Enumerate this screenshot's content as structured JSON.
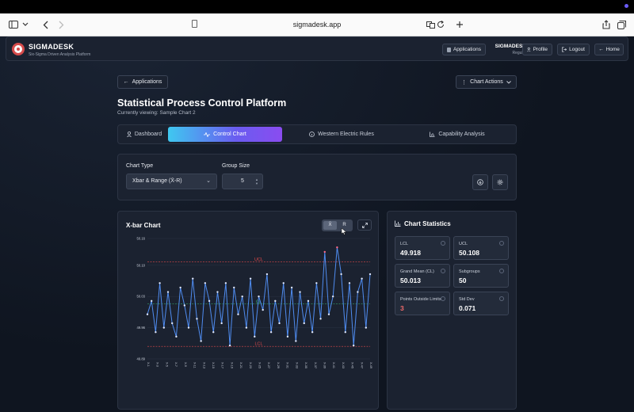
{
  "browser": {
    "url": "sigmadesk.app",
    "icons": [
      "sidebar-icon",
      "chevron-down-icon",
      "back-icon",
      "forward-icon",
      "reader-icon",
      "translate-icon",
      "reload-icon",
      "new-tab-icon",
      "share-icon",
      "tabs-icon"
    ]
  },
  "header": {
    "brand": "SIGMADESK",
    "tagline": "Six-Sigma Driven Analysis Platform",
    "applications_label": "Applications",
    "user_name": "SIGMADESK",
    "user_role": "Regular",
    "profile_label": "Profile",
    "logout_label": "Logout",
    "home_label": "Home"
  },
  "page": {
    "back_label": "Applications",
    "actions_label": "Chart Actions",
    "title": "Statistical Process Control Platform",
    "subtitle": "Currently viewing: Sample Chart 2"
  },
  "tabs": [
    {
      "label": "Dashboard",
      "icon": "user-icon",
      "active": false
    },
    {
      "label": "Control Chart",
      "icon": "activity-icon",
      "active": true
    },
    {
      "label": "Western Electric Rules",
      "icon": "info-icon",
      "active": false
    },
    {
      "label": "Capability Analysis",
      "icon": "bar-chart-icon",
      "active": false
    }
  ],
  "controls": {
    "chart_type_label": "Chart Type",
    "chart_type_value": "Xbar & Range (X̄-R)",
    "group_size_label": "Group Size",
    "group_size_value": "5"
  },
  "chart": {
    "title": "X-bar Chart",
    "toggle_xbar": "X̄",
    "toggle_r": "R"
  },
  "chart_data": {
    "type": "line",
    "title": "X-bar Chart",
    "ylim": [
      49.89,
      50.16
    ],
    "yticks": [
      "50.16",
      "50.10",
      "50.03",
      "49.96",
      "49.89"
    ],
    "xticks": [
      "X-1",
      "X-3",
      "X-5",
      "X-7",
      "X-9",
      "X-11",
      "X-13",
      "X-15",
      "X-17",
      "X-19",
      "X-21",
      "X-23",
      "X-25",
      "X-27",
      "X-29",
      "X-31",
      "X-33",
      "X-35",
      "X-37",
      "X-39",
      "X-41",
      "X-43",
      "X-45",
      "X-47",
      "X-49"
    ],
    "limits": {
      "UCL": 50.108,
      "CL": 50.013,
      "LCL": 49.918
    },
    "limit_labels": {
      "UCL": "UCL",
      "CL": "CL",
      "LCL": "LCL"
    },
    "colors": {
      "series": "#4f8cf0",
      "limit": "#e04a4a",
      "center": "#34c07a",
      "out_of_control": "#ff6a8a"
    },
    "values": [
      49.99,
      50.02,
      49.95,
      50.06,
      49.96,
      50.04,
      49.97,
      49.94,
      50.05,
      50.01,
      49.96,
      50.07,
      49.98,
      49.93,
      50.06,
      50.02,
      49.95,
      50.04,
      49.97,
      50.06,
      49.92,
      50.05,
      49.99,
      50.03,
      49.96,
      50.07,
      49.94,
      50.03,
      50.0,
      50.08,
      49.95,
      50.02,
      49.97,
      50.06,
      49.94,
      50.05,
      49.93,
      50.04,
      49.97,
      50.02,
      49.95,
      50.06,
      49.98,
      50.13,
      49.99,
      50.03,
      50.14,
      50.08,
      49.95,
      50.06,
      49.92,
      50.04,
      50.07,
      49.96,
      50.08
    ]
  },
  "stats": {
    "title": "Chart Statistics",
    "cards": [
      {
        "label": "LCL",
        "value": "49.918",
        "alert": false
      },
      {
        "label": "UCL",
        "value": "50.108",
        "alert": false
      },
      {
        "label": "Grand Mean (CL)",
        "value": "50.013",
        "alert": false
      },
      {
        "label": "Subgroups",
        "value": "50",
        "alert": false
      },
      {
        "label": "Points Outside Limits",
        "value": "3",
        "alert": true
      },
      {
        "label": "Std Dev",
        "value": "0.071",
        "alert": false
      }
    ]
  }
}
